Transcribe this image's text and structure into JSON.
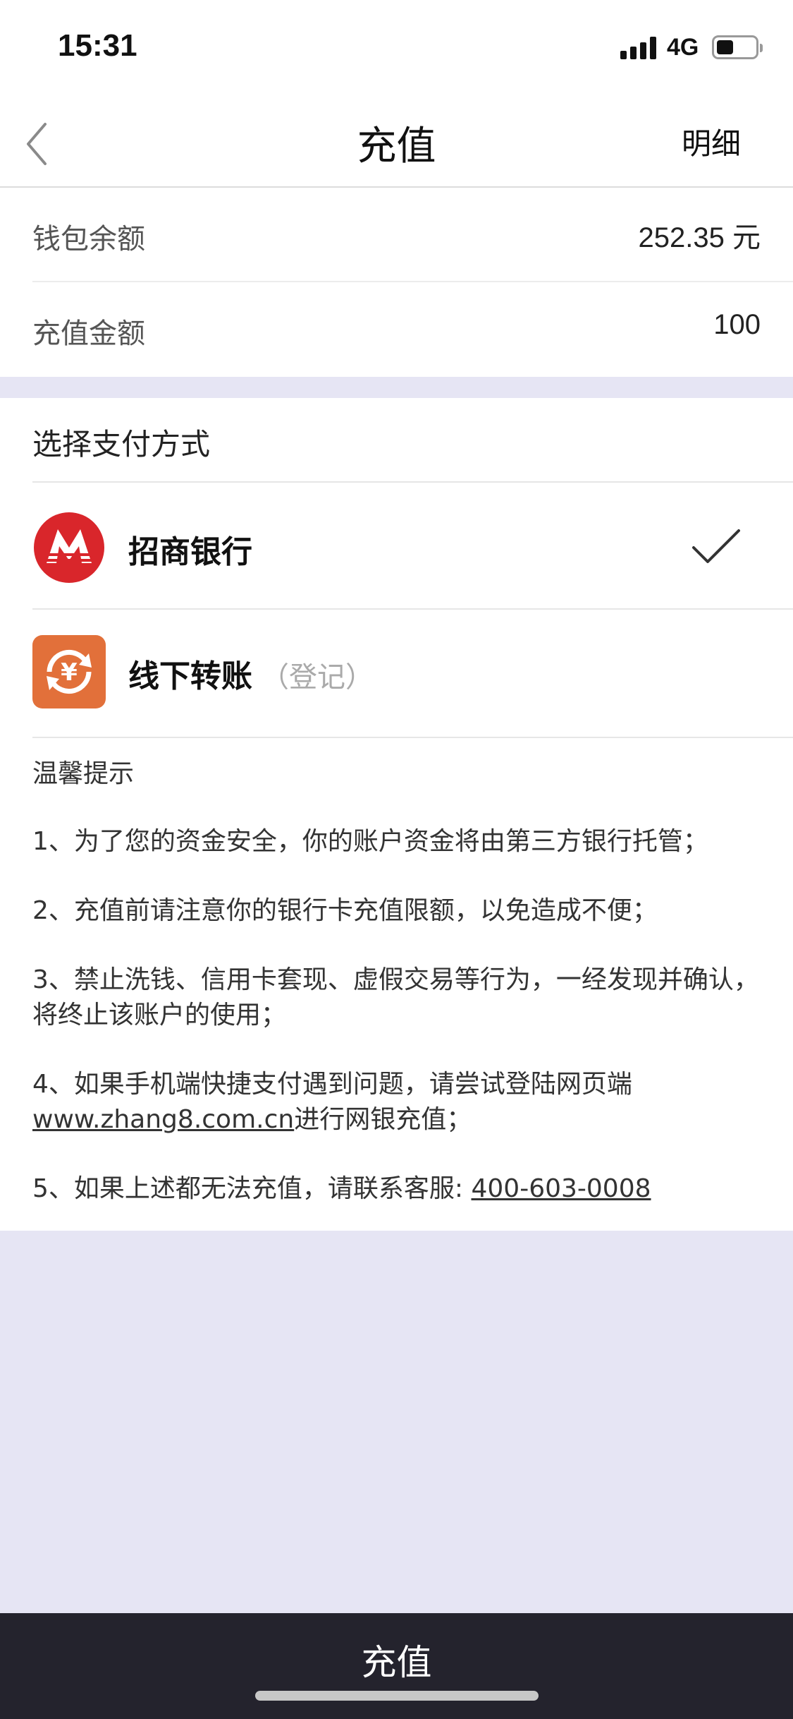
{
  "status_bar": {
    "time": "15:31",
    "network": "4G",
    "battery_level": 0.45
  },
  "nav": {
    "title": "充值",
    "detail": "明细"
  },
  "balance": {
    "wallet_label": "钱包余额",
    "wallet_value": "252.35 元",
    "amount_label": "充值金额",
    "amount_value": "100"
  },
  "payment": {
    "header": "选择支付方式",
    "options": [
      {
        "name": "招商银行",
        "note": "",
        "icon": "cmb-bank-logo-icon",
        "selected": true
      },
      {
        "name": "线下转账",
        "note": "（登记）",
        "icon": "yuan-transfer-icon",
        "selected": false
      }
    ]
  },
  "tips": {
    "title": "温馨提示",
    "t1": "1、为了您的资金安全，你的账户资金将由第三方银行托管；",
    "t2": "2、充值前请注意你的银行卡充值限额，以免造成不便；",
    "t3": "3、禁止洗钱、信用卡套现、虚假交易等行为，一经发现并确认，将终止该账户的使用；",
    "t4_prefix": "4、如果手机端快捷支付遇到问题，请尝试登陆网页端",
    "t4_link": "www.zhang8.com.cn",
    "t4_suffix": "进行网银充值；",
    "t5_prefix": "5、如果上述都无法充值，请联系客服: ",
    "t5_phone": "400-603-0008"
  },
  "bottom_button": {
    "label": "充值"
  },
  "colors": {
    "bank_red": "#d9262b",
    "transfer_orange": "#e2703a",
    "bottom_bar": "#24232d",
    "page_bg": "#e6e5f4"
  }
}
